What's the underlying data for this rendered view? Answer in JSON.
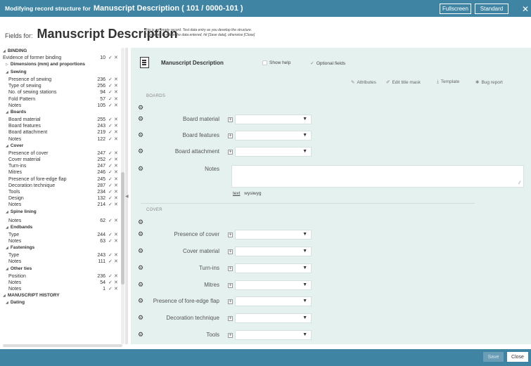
{
  "window": {
    "title_prefix": "Modifying record structure for",
    "title_record": "Manuscript Description  ( 101 / 0000-101 )",
    "fullscreen_label": "Fullscreen",
    "standard_label": "Standard",
    "close_label": "✕"
  },
  "header": {
    "fields_for_label": "Fields for:",
    "title": "Manuscript Description",
    "notice_line1": "This is an empty record. Test data entry as you develop the structure.",
    "notice_line2": "If you want to retain the data entered, hit [Save data], otherwise [Close]"
  },
  "tree": {
    "items": [
      {
        "kind": "sec",
        "label": "BINDING",
        "indent": 0
      },
      {
        "kind": "field",
        "label": "Evidence of former binding",
        "count": "10",
        "indent": 1
      },
      {
        "kind": "sub-collapsed",
        "label": "Dimensions (mm) and proportions",
        "indent": 2
      },
      {
        "kind": "sub",
        "label": "Sewing",
        "indent": 2
      },
      {
        "kind": "field",
        "label": "Presence of sewing",
        "count": "236",
        "indent": 3
      },
      {
        "kind": "field",
        "label": "Type of sewing",
        "count": "256",
        "indent": 3
      },
      {
        "kind": "field",
        "label": "No. of sewing stations",
        "count": "94",
        "indent": 3
      },
      {
        "kind": "field",
        "label": "Fold Pattern",
        "count": "57",
        "indent": 3
      },
      {
        "kind": "field",
        "label": "Notes",
        "count": "105",
        "indent": 3
      },
      {
        "kind": "sub",
        "label": "Boards",
        "indent": 2
      },
      {
        "kind": "field",
        "label": "Board material",
        "count": "255",
        "indent": 3
      },
      {
        "kind": "field",
        "label": "Board features",
        "count": "243",
        "indent": 3
      },
      {
        "kind": "field",
        "label": "Board attachment",
        "count": "219",
        "indent": 3
      },
      {
        "kind": "field",
        "label": "Notes",
        "count": "122",
        "indent": 3
      },
      {
        "kind": "sub",
        "label": "Cover",
        "indent": 2
      },
      {
        "kind": "field",
        "label": "Presence of cover",
        "count": "247",
        "indent": 3
      },
      {
        "kind": "field",
        "label": "Cover material",
        "count": "252",
        "indent": 3
      },
      {
        "kind": "field",
        "label": "Turn-ins",
        "count": "247",
        "indent": 3
      },
      {
        "kind": "field",
        "label": "Mitres",
        "count": "246",
        "indent": 3
      },
      {
        "kind": "field",
        "label": "Presence of fore-edge flap",
        "count": "245",
        "indent": 3
      },
      {
        "kind": "field",
        "label": "Decoration technique",
        "count": "287",
        "indent": 3
      },
      {
        "kind": "field",
        "label": "Tools",
        "count": "234",
        "indent": 3
      },
      {
        "kind": "field",
        "label": "Design",
        "count": "132",
        "indent": 3
      },
      {
        "kind": "field",
        "label": "Notes",
        "count": "214",
        "indent": 3
      },
      {
        "kind": "sub",
        "label": "Spine lining",
        "indent": 2
      },
      {
        "kind": "field",
        "label": "Notes",
        "count": "62",
        "indent": 3
      },
      {
        "kind": "sub",
        "label": "Endbands",
        "indent": 2
      },
      {
        "kind": "field",
        "label": "Type",
        "count": "244",
        "indent": 3
      },
      {
        "kind": "field",
        "label": "Notes",
        "count": "63",
        "indent": 3
      },
      {
        "kind": "sub",
        "label": "Fastenings",
        "indent": 2
      },
      {
        "kind": "field",
        "label": "Type",
        "count": "243",
        "indent": 3
      },
      {
        "kind": "field",
        "label": "Notes",
        "count": "111",
        "indent": 3
      },
      {
        "kind": "sub",
        "label": "Other ties",
        "indent": 2
      },
      {
        "kind": "field",
        "label": "Position",
        "count": "236",
        "indent": 3
      },
      {
        "kind": "field",
        "label": "Notes",
        "count": "54",
        "indent": 3
      },
      {
        "kind": "field",
        "label": "Notes",
        "count": "1",
        "indent": 3
      },
      {
        "kind": "sec",
        "label": "MANUSCRIPT HISTORY",
        "indent": 0
      },
      {
        "kind": "sub",
        "label": "Dating",
        "indent": 2
      }
    ]
  },
  "panel": {
    "title": "Manuscript Description",
    "show_help_label": "Show help",
    "optional_fields_label": "Optional fields",
    "toolbar": {
      "attributes": "Attributes",
      "edit_title_mask": "Edit title mask",
      "template": "Template",
      "bug_report": "Bug report"
    },
    "sections": [
      {
        "name": "BOARDS",
        "fields": [
          "Board material",
          "Board features",
          "Board attachment"
        ],
        "notes_label": "Notes",
        "notes_tabs": [
          "text",
          "wysiwyg"
        ]
      },
      {
        "name": "COVER",
        "fields": [
          "Presence of cover",
          "Cover material",
          "Turn-ins",
          "Mitres",
          "Presence of fore-edge flap",
          "Decoration technique",
          "Tools"
        ]
      }
    ]
  },
  "footer": {
    "save_label": "Save",
    "close_label": "Close"
  },
  "colors": {
    "bar": "#3f84a3",
    "panel_bg": "#e5f1ef"
  }
}
